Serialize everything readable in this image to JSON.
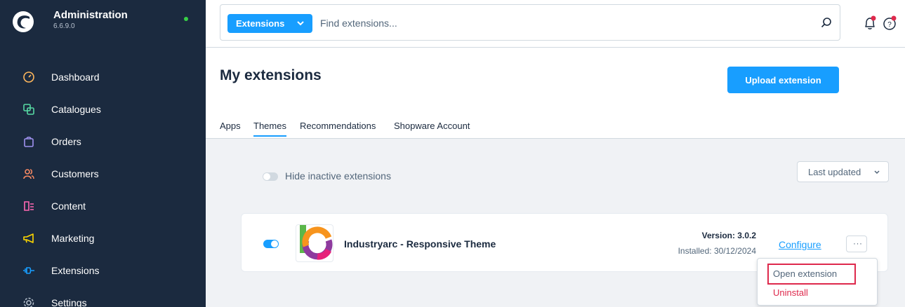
{
  "app": {
    "title": "Administration",
    "version": "6.6.9.0"
  },
  "sidebar": {
    "items": [
      {
        "label": "Dashboard",
        "icon": "dashboard-icon"
      },
      {
        "label": "Catalogues",
        "icon": "catalogues-icon"
      },
      {
        "label": "Orders",
        "icon": "orders-icon"
      },
      {
        "label": "Customers",
        "icon": "customers-icon"
      },
      {
        "label": "Content",
        "icon": "content-icon"
      },
      {
        "label": "Marketing",
        "icon": "marketing-icon"
      },
      {
        "label": "Extensions",
        "icon": "extensions-icon"
      },
      {
        "label": "Settings",
        "icon": "settings-icon"
      }
    ]
  },
  "search": {
    "type_label": "Extensions",
    "placeholder": "Find extensions..."
  },
  "header": {
    "title": "My extensions",
    "upload_label": "Upload extension"
  },
  "tabs": [
    {
      "label": "Apps",
      "active": false
    },
    {
      "label": "Themes",
      "active": true
    },
    {
      "label": "Recommendations",
      "active": false
    },
    {
      "label": "Shopware Account",
      "active": false
    }
  ],
  "filters": {
    "hide_inactive_label": "Hide inactive extensions",
    "sort_label": "Last updated"
  },
  "extension": {
    "name": "Industryarc - Responsive Theme",
    "version": "Version: 3.0.2",
    "installed": "Installed: 30/12/2024",
    "configure_label": "Configure",
    "more_label": "···"
  },
  "context_menu": {
    "open_label": "Open extension",
    "uninstall_label": "Uninstall"
  },
  "colors": {
    "sidebar_bg": "#1b2a3f",
    "accent": "#189eff",
    "danger": "#de294c",
    "online": "#37d046"
  }
}
